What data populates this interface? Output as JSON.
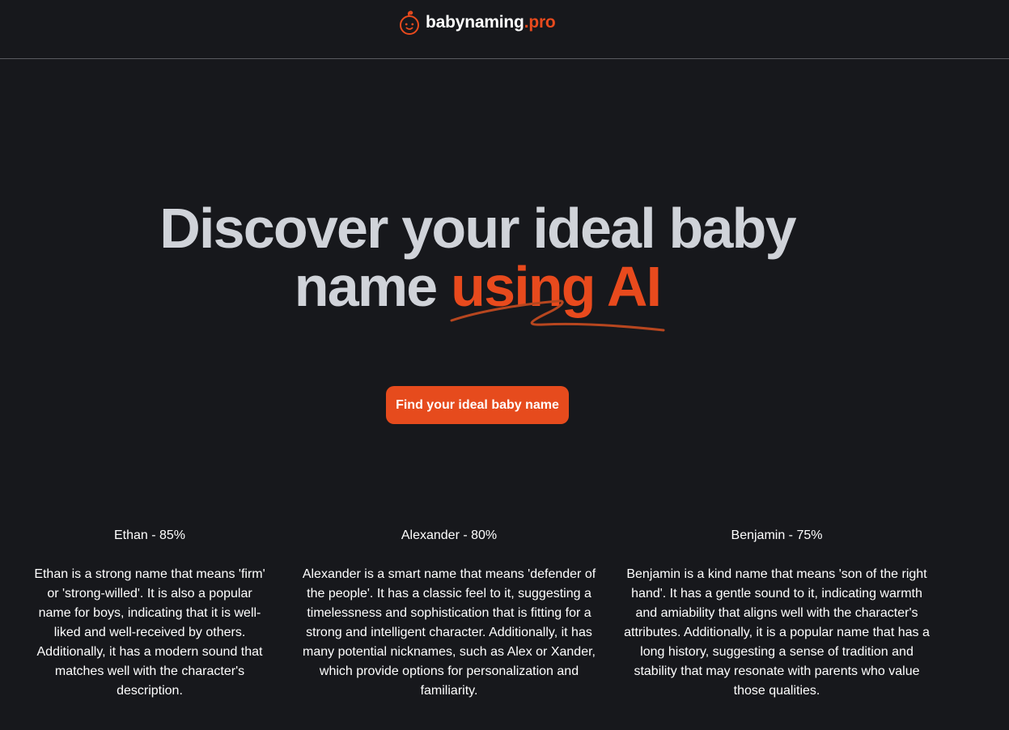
{
  "header": {
    "brand_name": "babynaming",
    "brand_tld": ".pro",
    "brand_icon": "baby-face-icon"
  },
  "hero": {
    "title_line1": "Discover your ideal baby",
    "title_line2_plain": "name",
    "title_line2_accent": "using AI",
    "cta_label": "Find your ideal baby name"
  },
  "names": [
    {
      "title": "Ethan - 85%",
      "description": "Ethan is a strong name that means 'firm' or 'strong-willed'. It is also a popular name for boys, indicating that it is well-liked and well-received by others. Additionally, it has a modern sound that matches well with the character's description."
    },
    {
      "title": "Alexander - 80%",
      "description": "Alexander is a smart name that means 'defender of the people'. It has a classic feel to it, suggesting a timelessness and sophistication that is fitting for a strong and intelligent character. Additionally, it has many potential nicknames, such as Alex or Xander, which provide options for personalization and familiarity."
    },
    {
      "title": "Benjamin - 75%",
      "description": "Benjamin is a kind name that means 'son of the right hand'. It has a gentle sound to it, indicating warmth and amiability that aligns well with the character's attributes. Additionally, it is a popular name that has a long history, suggesting a sense of tradition and stability that may resonate with parents who value those qualities."
    }
  ],
  "colors": {
    "background": "#17181c",
    "accent": "#e84a1d",
    "title": "#d0d3d9",
    "text": "#ffffff"
  }
}
